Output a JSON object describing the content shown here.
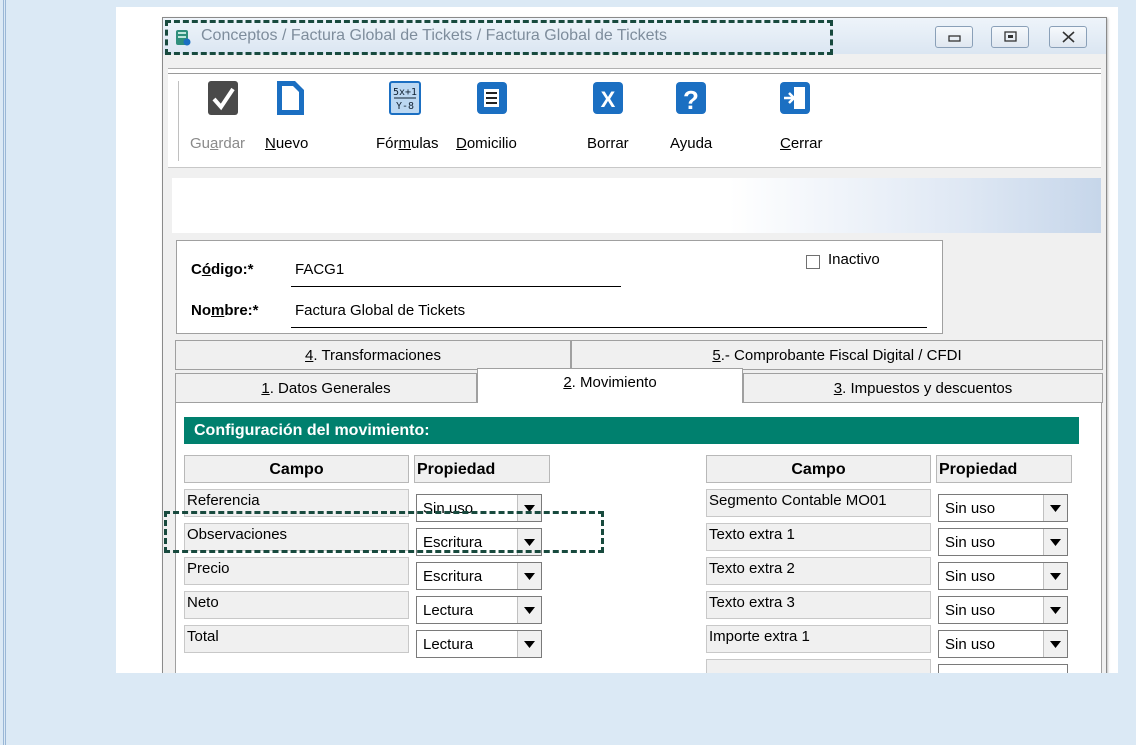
{
  "window": {
    "title": "Conceptos / Factura Global de Tickets / Factura Global de Tickets",
    "buttons": [
      "minimize-icon",
      "maximize-icon",
      "close-icon"
    ]
  },
  "toolbar": {
    "buttons": [
      {
        "icon": "checkmark-icon",
        "pre": "Gu",
        "acc": "a",
        "post": "rdar",
        "disabled": true
      },
      {
        "icon": "new-document-icon",
        "pre": "",
        "acc": "N",
        "post": "uevo",
        "disabled": false
      },
      {
        "icon": "formula-icon",
        "pre": "Fór",
        "acc": "m",
        "post": "ulas",
        "disabled": false
      },
      {
        "icon": "address-book-icon",
        "pre": "",
        "acc": "D",
        "post": "omicilio",
        "disabled": false
      },
      {
        "icon": "delete-x-icon",
        "pre": "",
        "acc": "",
        "post": "Borrar",
        "disabled": false
      },
      {
        "icon": "help-question-icon",
        "pre": "",
        "acc": "",
        "post": "Ayuda",
        "disabled": false
      },
      {
        "icon": "exit-door-icon",
        "pre": "",
        "acc": "C",
        "post": "errar",
        "disabled": false
      }
    ]
  },
  "form": {
    "code_label": {
      "pre": "C",
      "acc": "ó",
      "post": "digo:*"
    },
    "code_value": "FACG1",
    "name_label": {
      "pre": "No",
      "acc": "m",
      "post": "bre:*"
    },
    "name_value": "Factura Global de Tickets",
    "inactive_label": "Inactivo",
    "inactive_checked": false
  },
  "tabs": {
    "row1": [
      {
        "acc": "4",
        "post": ". Transformaciones"
      },
      {
        "acc": "5",
        "post": ".- Comprobante Fiscal Digital / CFDI"
      }
    ],
    "row2": [
      {
        "acc": "1",
        "post": ". Datos Generales",
        "active": false
      },
      {
        "acc": "2",
        "post": ". Movimiento",
        "active": true
      },
      {
        "acc": "3",
        "post": ". Impuestos y descuentos",
        "active": false
      }
    ]
  },
  "section_title": "Configuración del movimiento:",
  "left_table": {
    "headers": [
      "Campo",
      "Propiedad"
    ],
    "rows": [
      {
        "campo": "Referencia",
        "propiedad": "Sin uso"
      },
      {
        "campo": "Observaciones",
        "propiedad": "Escritura"
      },
      {
        "campo": "Precio",
        "propiedad": "Escritura"
      },
      {
        "campo": "Neto",
        "propiedad": "Lectura"
      },
      {
        "campo": "Total",
        "propiedad": "Lectura"
      }
    ]
  },
  "right_table": {
    "headers": [
      "Campo",
      "Propiedad"
    ],
    "rows": [
      {
        "campo": "Segmento Contable MO01",
        "propiedad": "Sin uso"
      },
      {
        "campo": "Texto extra 1",
        "propiedad": "Sin uso"
      },
      {
        "campo": "Texto extra 2",
        "propiedad": "Sin uso"
      },
      {
        "campo": "Texto extra 3",
        "propiedad": "Sin uso"
      },
      {
        "campo": "Importe extra 1",
        "propiedad": "Sin uso"
      }
    ]
  },
  "colors": {
    "section": "#00806e",
    "highlight": "#184a3e",
    "accent": "#1b6fc2"
  }
}
